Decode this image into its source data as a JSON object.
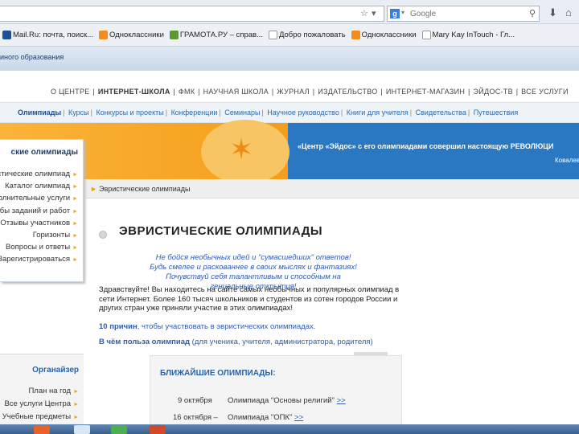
{
  "browser": {
    "search_placeholder": "Google",
    "bookmarks": [
      {
        "label": "Mail.Ru: почта, поиск...",
        "icon": "mail-ru-icon"
      },
      {
        "label": "Одноклассники",
        "icon": "odnoklassniki-icon"
      },
      {
        "label": "ГРАМОТА.РУ – справ...",
        "icon": "gramota-icon"
      },
      {
        "label": "Добро пожаловать",
        "icon": "page-icon"
      },
      {
        "label": "Одноклассники",
        "icon": "odnoklassniki-icon"
      },
      {
        "label": "Mary Kay InTouch - Гл...",
        "icon": "page-icon"
      }
    ]
  },
  "site": {
    "org_name": "иного образования",
    "nav_primary": [
      "О ЦЕНТРЕ",
      "ИНТЕРНЕТ-ШКОЛА",
      "ФМК",
      "НАУЧНАЯ ШКОЛА",
      "ЖУРНАЛ",
      "ИЗДАТЕЛЬСТВО",
      "ИНТЕРНЕТ-МАГАЗИН",
      "ЭЙДОС-ТВ",
      "ВСЕ УСЛУГИ"
    ],
    "nav_secondary": [
      "Олимпиады",
      "Курсы",
      "Конкурсы и проекты",
      "Конференции",
      "Семинары",
      "Научное руководство",
      "Книги для учителя",
      "Свидетельства",
      "Путешествия"
    ],
    "banner_text": "«Центр «Эйдос» с его олимпиадами совершил настоящую РЕВОЛЮЦИ",
    "banner_sub": "Ковалев",
    "breadcrumb": "Эвристические олимпиады"
  },
  "sidebar": {
    "title": "ские олимпиады",
    "items": [
      "эвристические олимпиад",
      "Каталог олимпиад",
      "Дополнительные услуги",
      "бы заданий и работ",
      "Отзывы участников",
      "Горизонты",
      "Вопросы и ответы",
      "Зарегистрироваться"
    ],
    "organizer_title": "Органайзер",
    "organizer_items": [
      "План на год",
      "Все услуги Центра",
      "Учебные предметы"
    ]
  },
  "main": {
    "title": "ЭВРИСТИЧЕСКИЕ ОЛИМПИАДЫ",
    "quote_lines": [
      "Не бойся необычных идей и \"сумасшедших\" ответов!",
      "Будь смелее и раскованнее в своих мыслях и фантазиях!",
      "Почувствуй себя талантливым и способным на гениальные открытия!"
    ],
    "intro": "Здравствуйте! Вы находитесь на сайте самых необычных и популярных олимпиад в сети Интернет. Более 160 тысяч школьников и студентов из сотен городов России и других стран уже приняли участие в этих олимпиадах!",
    "reasons_bold": "10 причин",
    "reasons_rest": ", чтобы участвовать в эвристических олимпиадах.",
    "benefit_bold": "В чём польза олимпиад",
    "benefit_rest": " (для ученика, учителя, администратора, родителя)",
    "events_title": "БЛИЖАЙШИЕ ОЛИМПИАДЫ:",
    "events": [
      {
        "date": "9 октября",
        "label": "Олимпиада \"Основы религий\"",
        "more": ">>"
      },
      {
        "date": "16 октября –",
        "label": "Олимпиада \"ОПК\"",
        "more": ">>"
      }
    ]
  }
}
